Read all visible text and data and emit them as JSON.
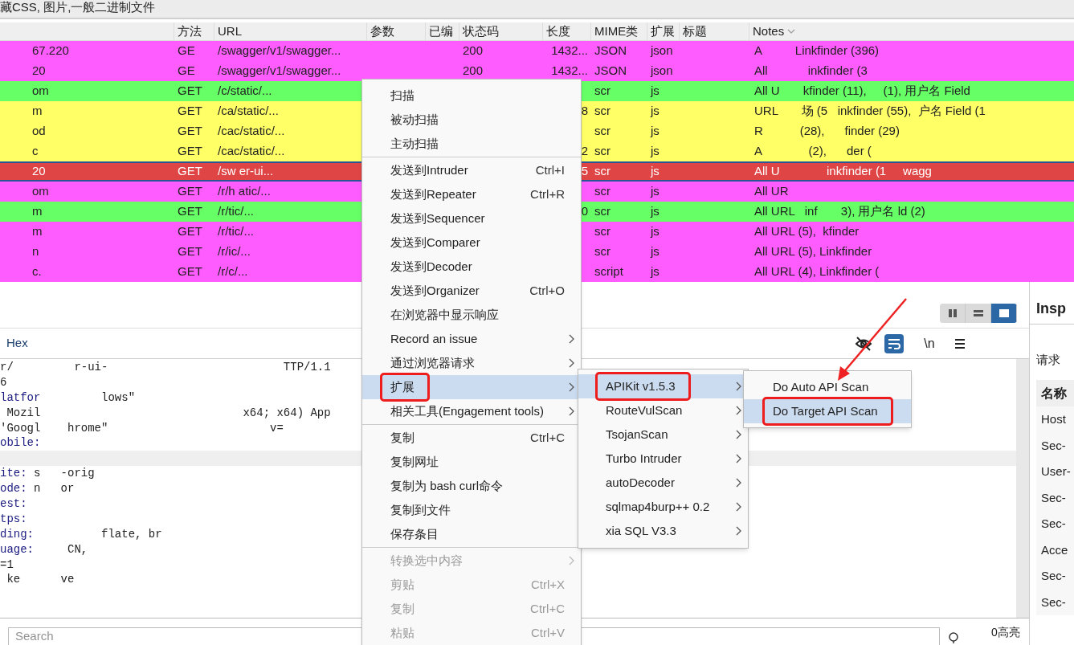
{
  "filter_bar": {
    "text": "藏CSS, 图片,一般二进制文件"
  },
  "table": {
    "columns": [
      "方法",
      "URL",
      "参数",
      "已编",
      "状态码",
      "长度",
      "MIME类",
      "扩展",
      "标题",
      "Notes"
    ],
    "rows": [
      {
        "host": "67.220",
        "method": "GE",
        "url": "/swagger/v1/swagger...",
        "status": "200",
        "length": "1432...",
        "mime": "JSON",
        "ext": "json",
        "notes": "A          Linkfinder (396)",
        "color": "#ff5cff",
        "selected": false
      },
      {
        "host": "20",
        "method": "GE",
        "url": "/swagger/v1/swagger...",
        "status": "200",
        "length": "1432...",
        "mime": "JSON",
        "ext": "json",
        "notes": "All            inkfinder (3",
        "color": "#ff5cff",
        "selected": false
      },
      {
        "host": "om",
        "method": "GET",
        "url": "/c/static/...",
        "mime": "scr",
        "ext": "js",
        "notes": "All U       kfinder (11),     (1), 用户名 Field",
        "color": "#66ff66",
        "selected": false
      },
      {
        "host": "m",
        "method": "GET",
        "url": "/ca/static/...",
        "length": "8",
        "mime": "scr",
        "ext": "js",
        "notes": "URL       场 (5   inkfinder (55),  户名 Field (1",
        "color": "#ffff66",
        "selected": false
      },
      {
        "host": "od",
        "method": "GET",
        "url": "/cac/static/...",
        "mime": "scr",
        "ext": "js",
        "notes": "R           (28),      finder (29)",
        "color": "#ffff66",
        "selected": false
      },
      {
        "host": "c",
        "method": "GET",
        "url": "/cac/static/...",
        "length": "2",
        "mime": "scr",
        "ext": "js",
        "notes": "A              (2),      der (",
        "color": "#ffff66",
        "selected": false
      },
      {
        "host": "20",
        "method": "GET",
        "url": "/sw er-ui...",
        "length": "5",
        "mime": "scr",
        "ext": "js",
        "notes": "All U              inkfinder (1     wagg",
        "color": "#e04545",
        "selected": true
      },
      {
        "host": "om",
        "method": "GET",
        "url": "/r/h atic/...",
        "mime": "scr",
        "ext": "js",
        "notes": "All UR",
        "color": "#ff5cff",
        "selected": false
      },
      {
        "host": "m",
        "method": "GET",
        "url": "/r/tic/...",
        "length": "0",
        "mime": "scr",
        "ext": "js",
        "notes": "All URL   inf       3), 用户名 ld (2)",
        "color": "#66ff66",
        "selected": false
      },
      {
        "host": "m",
        "method": "GET",
        "url": "/r/tic/...",
        "mime": "scr",
        "ext": "js",
        "notes": "All URL (5),  kfinder",
        "color": "#ff5cff",
        "selected": false
      },
      {
        "host": "n",
        "method": "GET",
        "url": "/r/ic/...",
        "mime": "scr",
        "ext": "js",
        "notes": "All URL (5), Linkfinder",
        "color": "#ff5cff",
        "selected": false
      },
      {
        "host": "c.",
        "method": "GET",
        "url": "/r/c/...",
        "mime": "script",
        "ext": "js",
        "notes": "All URL (4), Linkfinder (",
        "color": "#ff5cff",
        "selected": false
      }
    ]
  },
  "editor": {
    "view_modes": [
      {
        "selected": false
      },
      {
        "selected": false
      },
      {
        "selected": true
      }
    ],
    "tabs": [
      {
        "label": "Hex"
      }
    ],
    "toolbar": [
      {
        "kind": "hide",
        "on": false
      },
      {
        "kind": "wrap",
        "on": true
      },
      {
        "kind": "newline",
        "label": "\\n",
        "on": false
      },
      {
        "kind": "menu",
        "on": false
      }
    ],
    "lines": [
      {
        "value": "r/         r-ui-                          TTP/1.1"
      },
      {
        "value": "6"
      },
      {
        "name": "latfor",
        "value": "         lows\""
      },
      {
        "value": " Mozil                              x64; x64) App"
      },
      {
        "value": "'Googl    hrome\"                        v="
      },
      {
        "name": "obile:"
      },
      {
        "highlighted": true
      },
      {
        "name": "ite:",
        "value": " s   -orig"
      },
      {
        "name": "ode:",
        "value": " n   or"
      },
      {
        "name": "est:"
      },
      {
        "name": "tps:"
      },
      {
        "name": "ding:",
        "value": "          flate, br"
      },
      {
        "name": "uage:",
        "value": "     CN,"
      },
      {
        "value": "=1"
      },
      {
        "value": " ke      ve"
      }
    ],
    "search": {
      "placeholder": "Search"
    },
    "highlights": "0高亮"
  },
  "inspector": {
    "title": "Insp",
    "section": "请求",
    "column": "名称",
    "rows": [
      "Host",
      "Sec-",
      "User-",
      "Sec-",
      "Sec-",
      "Acce",
      "Sec-",
      "Sec-"
    ]
  },
  "context_menu": {
    "groups": [
      [
        {
          "label": "扫描",
          "submenu": false,
          "disabled": false,
          "selected": false
        },
        {
          "label": "被动扫描",
          "submenu": false,
          "disabled": false,
          "selected": false
        },
        {
          "label": "主动扫描",
          "submenu": false,
          "disabled": false,
          "selected": false
        }
      ],
      [
        {
          "label": "发送到Intruder",
          "shortcut": "Ctrl+I",
          "submenu": false,
          "disabled": false,
          "selected": false
        },
        {
          "label": "发送到Repeater",
          "shortcut": "Ctrl+R",
          "submenu": false,
          "disabled": false,
          "selected": false
        },
        {
          "label": "发送到Sequencer",
          "submenu": false,
          "disabled": false,
          "selected": false
        },
        {
          "label": "发送到Comparer",
          "submenu": false,
          "disabled": false,
          "selected": false
        },
        {
          "label": "发送到Decoder",
          "submenu": false,
          "disabled": false,
          "selected": false
        },
        {
          "label": "发送到Organizer",
          "shortcut": "Ctrl+O",
          "submenu": false,
          "disabled": false,
          "selected": false
        },
        {
          "label": "在浏览器中显示响应",
          "submenu": false,
          "disabled": false,
          "selected": false
        },
        {
          "label": "Record an issue",
          "submenu": true,
          "disabled": false,
          "selected": false
        },
        {
          "label": "通过浏览器请求",
          "submenu": true,
          "disabled": false,
          "selected": false
        },
        {
          "label": "扩展",
          "submenu": true,
          "disabled": false,
          "selected": true
        },
        {
          "label": "相关工具(Engagement tools)",
          "submenu": true,
          "disabled": false,
          "selected": false
        }
      ],
      [
        {
          "label": "复制",
          "shortcut": "Ctrl+C",
          "submenu": false,
          "disabled": false,
          "selected": false
        },
        {
          "label": "复制网址",
          "submenu": false,
          "disabled": false,
          "selected": false
        },
        {
          "label": "复制为 bash curl命令",
          "submenu": false,
          "disabled": false,
          "selected": false
        },
        {
          "label": "复制到文件",
          "submenu": false,
          "disabled": false,
          "selected": false
        },
        {
          "label": "保存条目",
          "submenu": false,
          "disabled": false,
          "selected": false
        }
      ],
      [
        {
          "label": "转换选中内容",
          "submenu": true,
          "disabled": true,
          "selected": false
        },
        {
          "label": "剪贴",
          "shortcut": "Ctrl+X",
          "submenu": false,
          "disabled": true,
          "selected": false
        },
        {
          "label": "复制",
          "shortcut": "Ctrl+C",
          "submenu": false,
          "disabled": true,
          "selected": false
        },
        {
          "label": "粘贴",
          "shortcut": "Ctrl+V",
          "submenu": false,
          "disabled": true,
          "selected": false
        }
      ]
    ]
  },
  "extensions_menu": {
    "items": [
      {
        "label": "APIKit v1.5.3",
        "selected": true
      },
      {
        "label": "RouteVulScan",
        "selected": false
      },
      {
        "label": "TsojanScan",
        "selected": false
      },
      {
        "label": "Turbo Intruder",
        "selected": false
      },
      {
        "label": "autoDecoder",
        "selected": false
      },
      {
        "label": "sqlmap4burp++ 0.2",
        "selected": false
      },
      {
        "label": "xia SQL V3.3",
        "selected": false
      }
    ]
  },
  "apikit_menu": {
    "items": [
      {
        "label": "Do Auto API Scan",
        "selected": false
      },
      {
        "label": "Do Target API Scan",
        "selected": true
      }
    ]
  }
}
